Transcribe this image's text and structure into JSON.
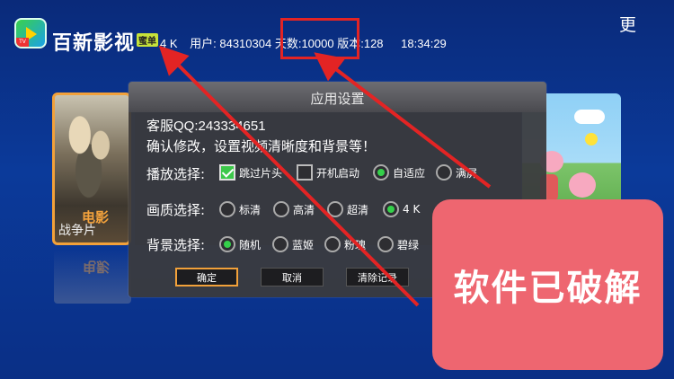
{
  "header": {
    "app_title": "百新影视",
    "vip_badge": "蜜单",
    "logo_corner": "TV",
    "quality": "4 K",
    "user": "用户: 84310304",
    "days": "天数:10000",
    "version": "版本:128",
    "time": "18:34:29",
    "more": "更"
  },
  "posters": {
    "left_caption": "电影",
    "left_subtitle": "战争片"
  },
  "dialog": {
    "title": "应用设置",
    "service_qq": "客服QQ:243334651",
    "hint": "确认修改，设置视频清晰度和背景等！",
    "play_row": {
      "label": "播放选择:",
      "options": [
        {
          "label": "跳过片头",
          "type": "checkbox",
          "checked": true
        },
        {
          "label": "开机启动",
          "type": "checkbox",
          "checked": false
        },
        {
          "label": "自适应",
          "type": "radio",
          "checked": true
        },
        {
          "label": "满屏",
          "type": "radio",
          "checked": false
        }
      ]
    },
    "quality_row": {
      "label": "画质选择:",
      "options": [
        {
          "label": "标清",
          "checked": false
        },
        {
          "label": "高清",
          "checked": false
        },
        {
          "label": "超清",
          "checked": false
        },
        {
          "label": "4 K",
          "checked": true
        }
      ]
    },
    "background_row": {
      "label": "背景选择:",
      "options": [
        {
          "label": "随机",
          "checked": true
        },
        {
          "label": "蓝姬",
          "checked": false
        },
        {
          "label": "粉瑰",
          "checked": false
        },
        {
          "label": "碧绿",
          "checked": false
        }
      ]
    },
    "buttons": {
      "confirm": "确定",
      "cancel": "取消",
      "clear_history": "清除记录"
    }
  },
  "banner": {
    "text": "软件已破解"
  },
  "colors": {
    "background": "#0b3a9a",
    "annotation_red": "#e32424",
    "banner": "#ee6670",
    "focus_orange": "#f2a13a",
    "checked_green": "#34d04a"
  }
}
